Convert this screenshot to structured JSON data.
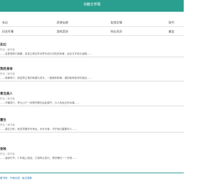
{
  "header": {
    "title": "书籍文学网"
  },
  "nav": {
    "row1": [
      "玄幻",
      "武侠仙侠",
      "女频言情",
      "现代"
    ],
    "row2": [
      "历史军事",
      "游戏竞技",
      "科幻灵异",
      "美女"
    ]
  },
  "books": [
    {
      "name": "玄幻",
      "author": "佚名 / 某作者",
      "desc": "……这里是简介摘要，讲述主角在异世界中成长历险的故事，此处文字较长省略……"
    },
    {
      "name": "我的身体",
      "author": "佚名 / 某作者",
      "desc": "……故事简介，描述男主角的奇遇与成长，一路披荆斩棘，遇到各种各样的挑战……"
    },
    {
      "name": "青云美人",
      "author": "佚名 / 某作者",
      "desc": "……开篇简介，青云山下一段恩怨情仇由此展开，众人命运交织纠缠……"
    },
    {
      "name": "重生",
      "author": "佚名 / 某作者",
      "desc": "……重生归来，她发誓要改写命运，步步为营，守护身边重要的人……"
    },
    {
      "name": "金秋",
      "author": "佚名 / 某作者",
      "desc": "……金秋时节，少年踏上旅途，江湖风云变幻，恩怨情仇一一浮现……"
    }
  ],
  "footer": {
    "text": "看书网 · 书海无涯 · 每日更新"
  }
}
